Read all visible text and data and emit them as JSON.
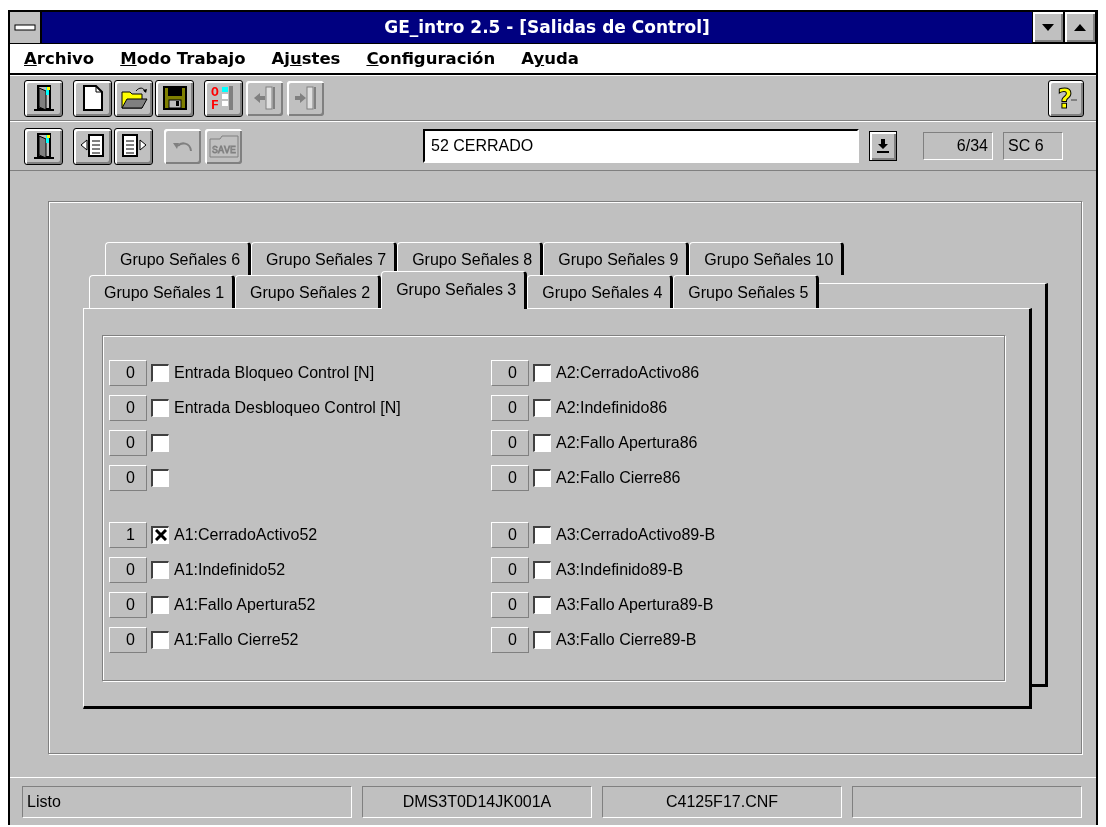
{
  "window": {
    "title": "GE_intro 2.5 - [Salidas de Control]"
  },
  "menu": [
    {
      "key": "A",
      "post": "rchivo"
    },
    {
      "key": "M",
      "post": "odo Trabajo"
    },
    {
      "pre": "Aj",
      "key": "u",
      "post": "stes"
    },
    {
      "key": "C",
      "post": "onfiguración"
    },
    {
      "pre": "A",
      "key": "y",
      "post": "uda"
    }
  ],
  "toolbar_1": {
    "groups": [
      [
        {
          "kind": "door",
          "disabled": false
        }
      ],
      [
        {
          "kind": "new",
          "disabled": false
        },
        {
          "kind": "open",
          "disabled": false
        },
        {
          "kind": "save",
          "disabled": false
        }
      ],
      [
        {
          "kind": "onoff",
          "disabled": false,
          "text": "OF"
        },
        {
          "kind": "import",
          "disabled": true
        },
        {
          "kind": "export",
          "disabled": true
        }
      ]
    ],
    "help": {
      "text": "?"
    }
  },
  "toolbar_2": {
    "groups": [
      [
        {
          "kind": "door",
          "disabled": false
        }
      ],
      [
        {
          "kind": "prev",
          "disabled": false
        },
        {
          "kind": "next",
          "disabled": false
        }
      ],
      [
        {
          "kind": "undo",
          "disabled": true
        },
        {
          "kind": "savetext",
          "disabled": true,
          "text": "SAVE"
        }
      ]
    ],
    "selector": {
      "value": "52 CERRADO"
    },
    "counter": "6/34",
    "code": "SC 6"
  },
  "tabs": {
    "back_row": [
      {
        "label": "Grupo Señales 6",
        "selected": false
      },
      {
        "label": "Grupo Señales 7",
        "selected": false
      },
      {
        "label": "Grupo Señales 8",
        "selected": false
      },
      {
        "label": "Grupo Señales 9",
        "selected": false
      },
      {
        "label": "Grupo Señales 10",
        "selected": false
      }
    ],
    "front_row": [
      {
        "label": "Grupo Señales 1",
        "selected": false
      },
      {
        "label": "Grupo Señales 2",
        "selected": false
      },
      {
        "label": "Grupo Señales 3",
        "selected": true
      },
      {
        "label": "Grupo Señales 4",
        "selected": false
      },
      {
        "label": "Grupo Señales 5",
        "selected": false
      }
    ]
  },
  "signals": {
    "blocks": [
      {
        "left": [
          {
            "value": "0",
            "checked": false,
            "label": "Entrada Bloqueo Control [N]"
          },
          {
            "value": "0",
            "checked": false,
            "label": "Entrada Desbloqueo Control [N]"
          },
          {
            "value": "0",
            "checked": false
          },
          {
            "value": "0",
            "checked": false
          }
        ],
        "right": [
          {
            "value": "0",
            "checked": false,
            "label": "A2:CerradoActivo86"
          },
          {
            "value": "0",
            "checked": false,
            "label": "A2:Indefinido86"
          },
          {
            "value": "0",
            "checked": false,
            "label": "A2:Fallo Apertura86"
          },
          {
            "value": "0",
            "checked": false,
            "label": "A2:Fallo Cierre86"
          }
        ]
      },
      {
        "left": [
          {
            "value": "1",
            "checked": true,
            "label": "A1:CerradoActivo52"
          },
          {
            "value": "0",
            "checked": false,
            "label": "A1:Indefinido52"
          },
          {
            "value": "0",
            "checked": false,
            "label": "A1:Fallo Apertura52"
          },
          {
            "value": "0",
            "checked": false,
            "label": "A1:Fallo Cierre52"
          }
        ],
        "right": [
          {
            "value": "0",
            "checked": false,
            "label": "A3:CerradoActivo89-B"
          },
          {
            "value": "0",
            "checked": false,
            "label": "A3:Indefinido89-B"
          },
          {
            "value": "0",
            "checked": false,
            "label": "A3:Fallo Apertura89-B"
          },
          {
            "value": "0",
            "checked": false,
            "label": "A3:Fallo Cierre89-B"
          }
        ]
      }
    ]
  },
  "status_bar": [
    "Listo",
    "DMS3T0D14JK001A",
    "C4125F17.CNF"
  ]
}
